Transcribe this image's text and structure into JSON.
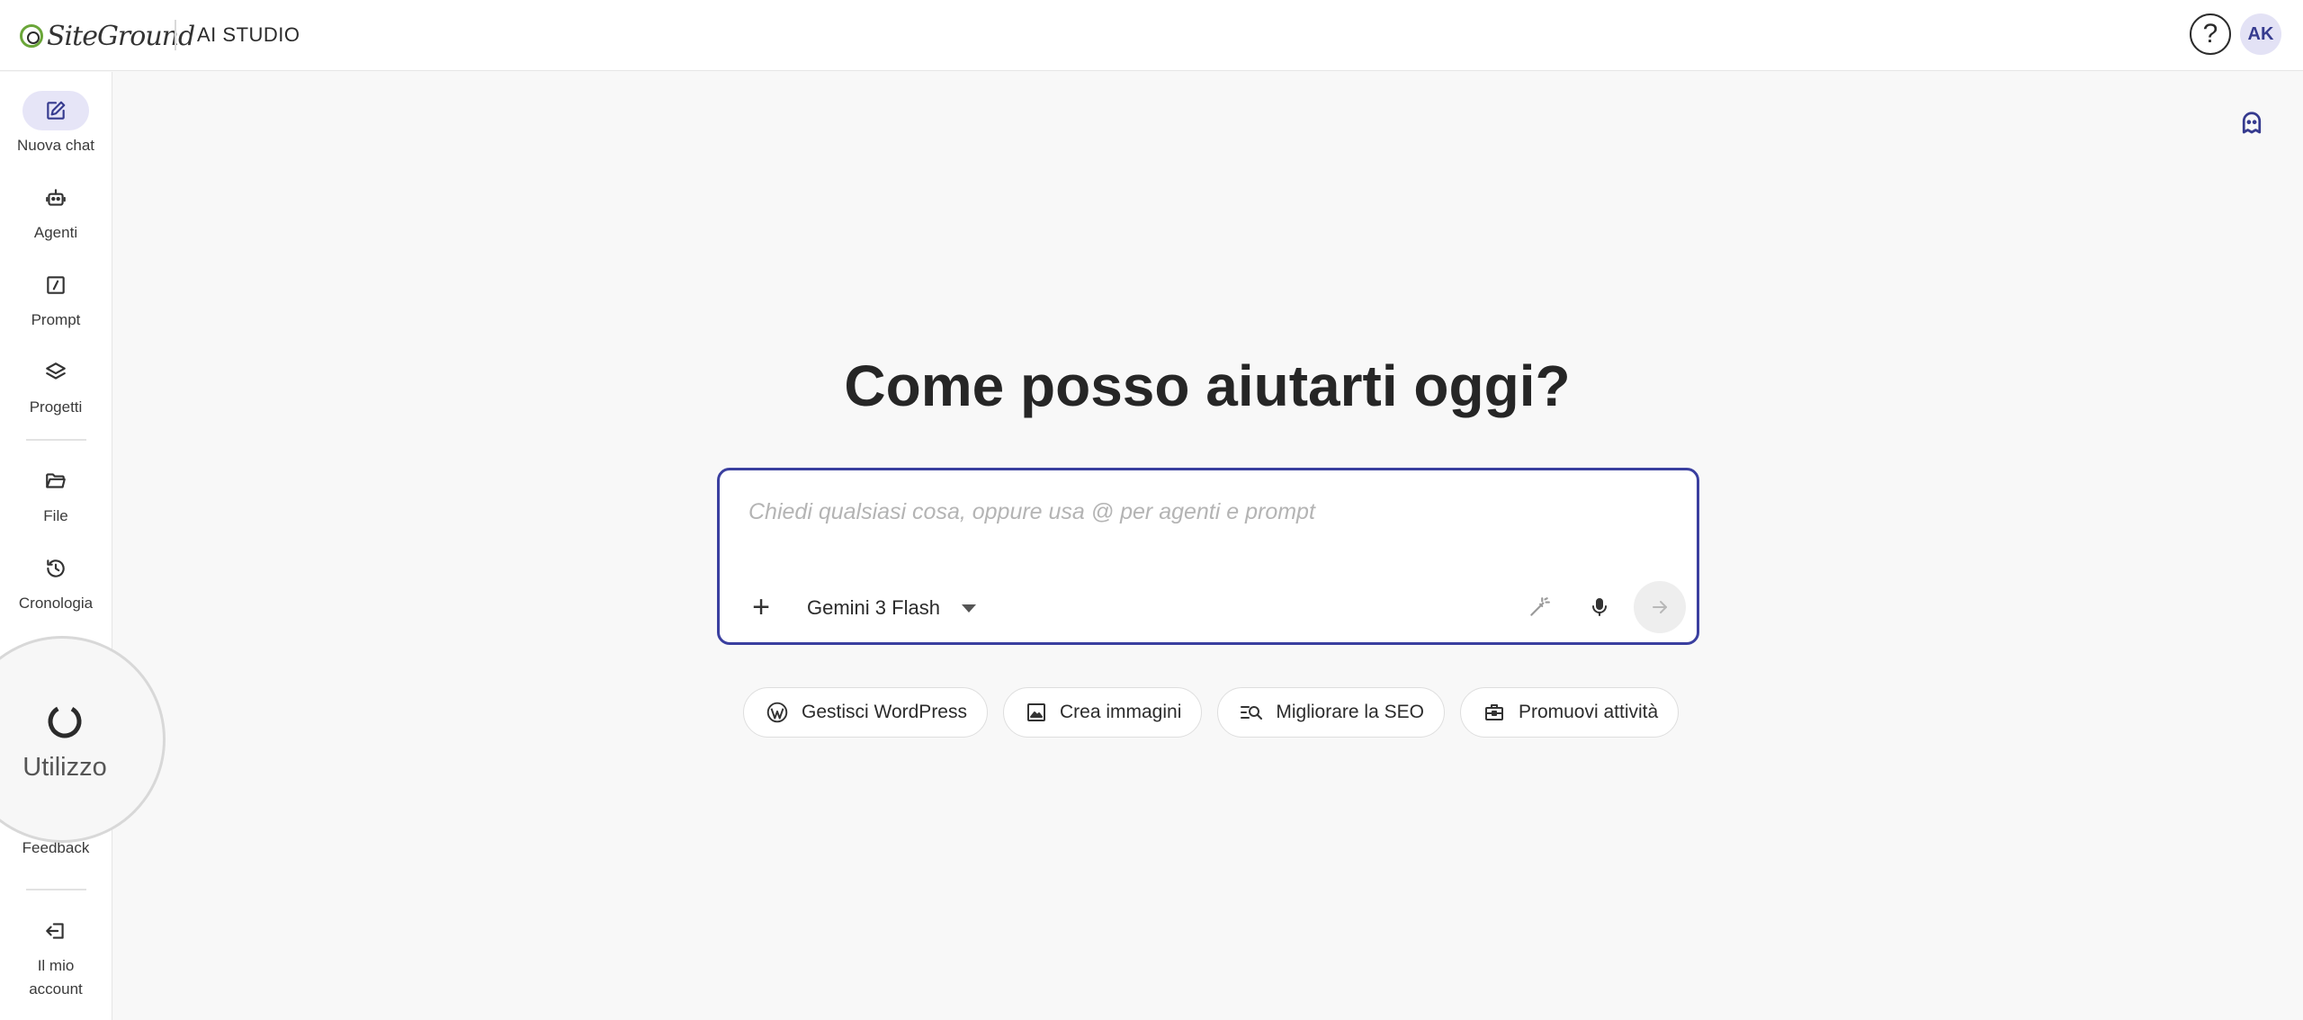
{
  "header": {
    "brand": "SiteGround",
    "product": "AI STUDIO",
    "help_symbol": "?",
    "avatar_initials": "AK"
  },
  "sidebar": {
    "items": [
      {
        "label": "Nuova chat",
        "icon": "edit-icon",
        "active": true
      },
      {
        "label": "Agenti",
        "icon": "robot-icon"
      },
      {
        "label": "Prompt",
        "icon": "prompt-icon"
      },
      {
        "label": "Progetti",
        "icon": "layers-icon"
      },
      {
        "label": "File",
        "icon": "folder-icon"
      },
      {
        "label": "Cronologia",
        "icon": "history-icon"
      },
      {
        "label": "Feedback",
        "icon": "feedback-icon"
      },
      {
        "label": "Il mio account",
        "icon": "logout-icon"
      }
    ],
    "usage": {
      "label": "Utilizzo",
      "icon": "usage-ring-icon"
    }
  },
  "main": {
    "headline": "Come posso aiutarti oggi?",
    "composer": {
      "placeholder": "Chiedi qualsiasi cosa, oppure usa @ per agenti e prompt",
      "value": "",
      "model": "Gemini 3 Flash"
    },
    "suggestions": [
      {
        "label": "Gestisci WordPress",
        "icon": "wordpress-icon"
      },
      {
        "label": "Crea immagini",
        "icon": "image-icon"
      },
      {
        "label": "Migliorare la SEO",
        "icon": "seo-search-icon"
      },
      {
        "label": "Promuovi attività",
        "icon": "briefcase-icon"
      }
    ]
  },
  "colors": {
    "accent": "#3a3f9f",
    "avatar_bg": "#e3e2f5",
    "active_nav_bg": "#e6e5f7",
    "brand_green": "#6aa639"
  }
}
